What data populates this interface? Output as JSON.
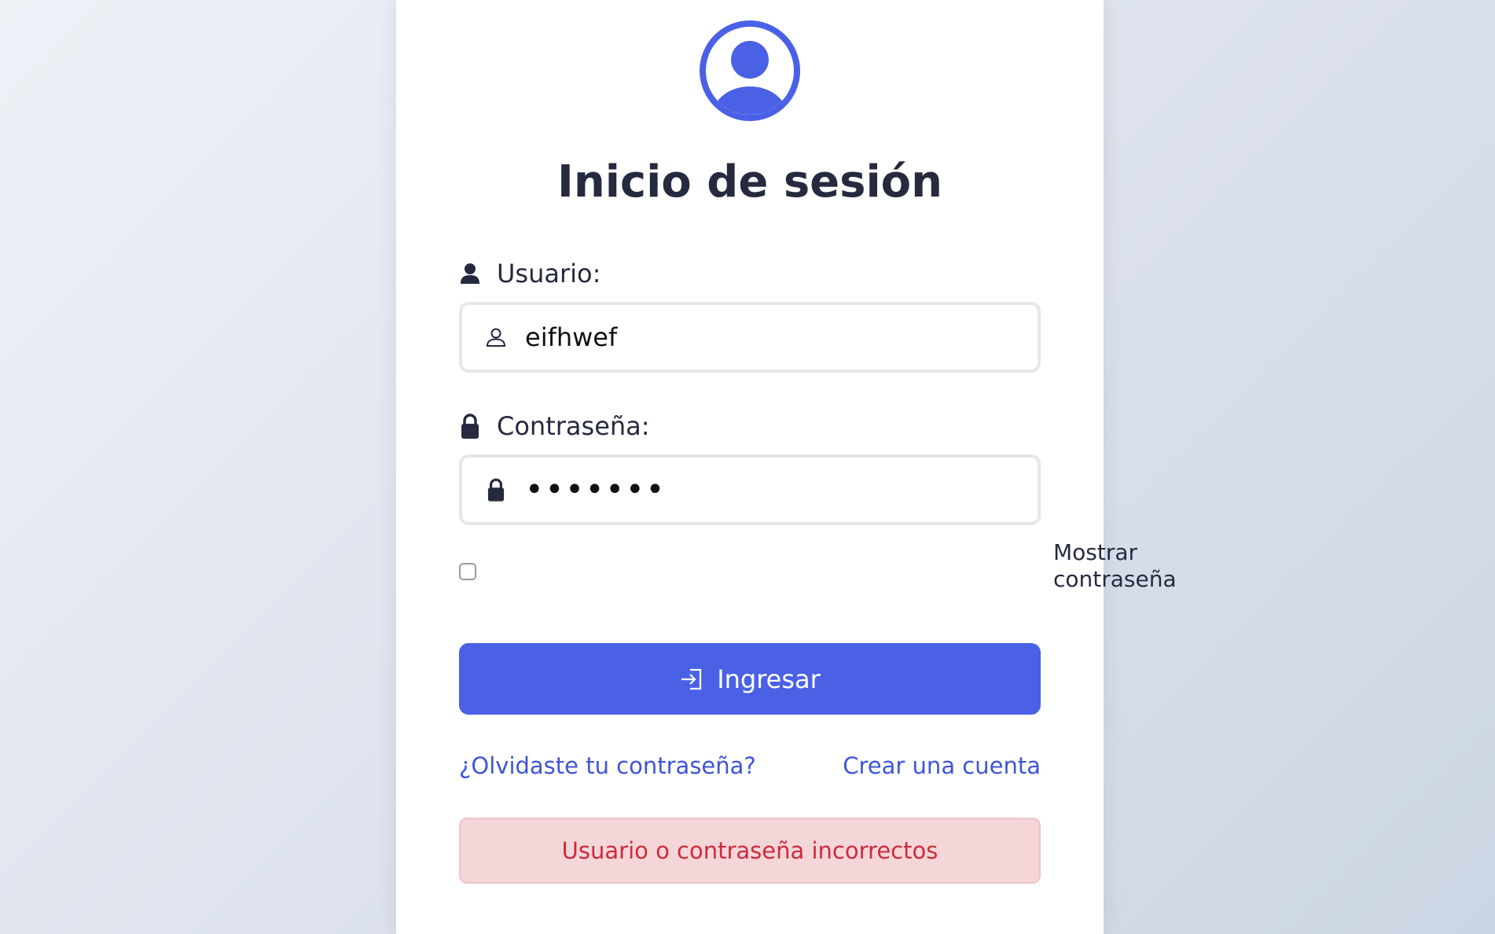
{
  "login": {
    "title": "Inicio de sesión",
    "avatar_icon": "user-circle-icon",
    "username": {
      "label": "Usuario:",
      "label_icon": "user-icon",
      "input_icon": "user-outline-icon",
      "value": "eifhwef"
    },
    "password": {
      "label": "Contraseña:",
      "label_icon": "lock-icon",
      "input_icon": "lock-icon",
      "value": "•••••••",
      "masked": true
    },
    "show_password": {
      "label": "Mostrar contraseña",
      "checked": false
    },
    "submit": {
      "label": "Ingresar",
      "icon": "sign-in-icon"
    },
    "forgot_link": "¿Olvidaste tu contraseña?",
    "register_link": "Crear una cuenta",
    "error_message": "Usuario o contraseña incorrectos"
  },
  "colors": {
    "accent": "#4a61e6",
    "title": "#262a3f",
    "link": "#3f55d8",
    "error_text": "#cf2a3a",
    "error_bg": "#f4d6d9"
  }
}
